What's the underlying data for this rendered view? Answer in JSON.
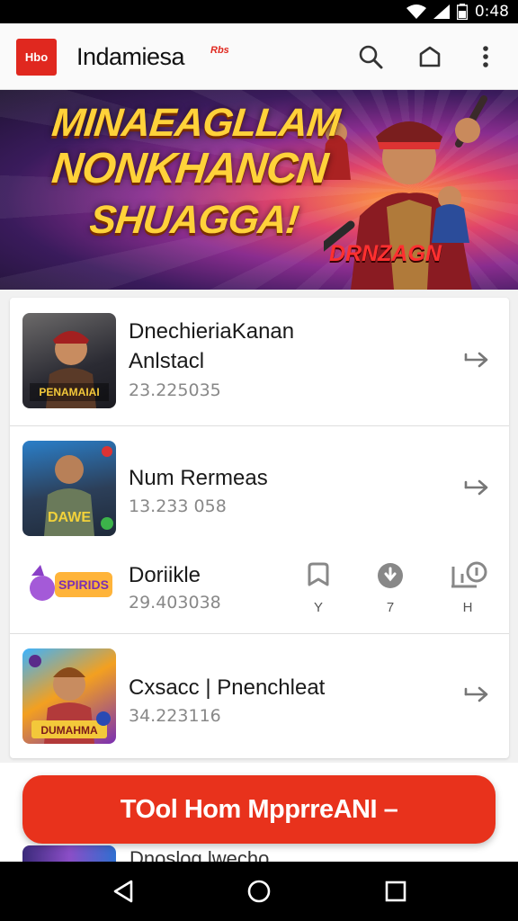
{
  "status_bar": {
    "time": "0:48"
  },
  "app_bar": {
    "logo_text": "Hbo",
    "title": "Indamiesa",
    "badge": "Rbs",
    "icons": [
      "search-icon",
      "home-icon",
      "more-vertical-icon"
    ]
  },
  "banner": {
    "headline_line1": "MINAEAGLLAM",
    "headline_line2": "NONKHANCN",
    "headline_line3": "SHUAGGA!",
    "tag": "DRNZAGN"
  },
  "list": {
    "items": [
      {
        "title_line1": "DnechieriaKanan",
        "title_line2": "Anlstacl",
        "count": "23.225035",
        "action_icon": "share-arrow-icon"
      },
      {
        "title_line1": "Num Rermeas",
        "title_line2": "",
        "count": "13.233 058",
        "action_icon": "share-arrow-icon"
      },
      {
        "title_line1": "Doriikle",
        "title_line2": "",
        "count": "29.403038",
        "actions": [
          {
            "icon": "bookmark-icon",
            "label": "Y"
          },
          {
            "icon": "pin-icon",
            "label": "7"
          },
          {
            "icon": "badge-icon",
            "label": "H"
          }
        ]
      },
      {
        "title_line1": "Cxsacc | Pnenchleat",
        "title_line2": "",
        "count": "34.223116",
        "action_icon": "share-arrow-icon"
      }
    ]
  },
  "cta": {
    "label": "TOol Hom MpprreANI –"
  },
  "peek": {
    "text": "Dnoslog lwecho"
  },
  "colors": {
    "accent": "#e8321c",
    "banner_text": "#ffd23a"
  }
}
